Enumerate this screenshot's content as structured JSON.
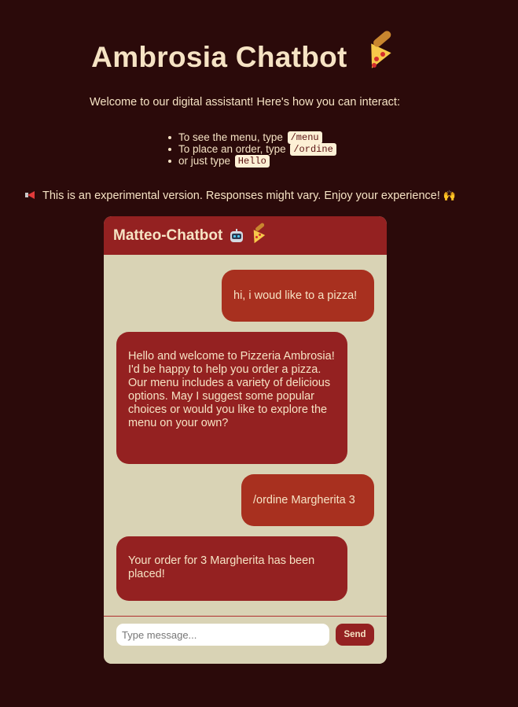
{
  "page": {
    "title": "Ambrosia Chatbot",
    "title_icon": "pizza-icon",
    "welcome": "Welcome to our digital assistant! Here's how you can interact:",
    "instructions": [
      {
        "text": "To see the menu, type",
        "code": "/menu"
      },
      {
        "text": "To place an order, type",
        "code": "/ordine"
      },
      {
        "text": "or just type",
        "code": "Hello"
      }
    ],
    "notice": {
      "icon": "megaphone-icon",
      "text": "This is an experimental version. Responses might vary. Enjoy your experience!",
      "trailing_icon": "raising-hands-icon"
    }
  },
  "chat": {
    "header_title": "Matteo-Chatbot",
    "header_icons": [
      "robot-icon",
      "pizza-icon"
    ],
    "messages": [
      {
        "sender": "user",
        "text": "hi, i woud like to a pizza!"
      },
      {
        "sender": "bot",
        "text": "Hello and welcome to Pizzeria Ambrosia! I'd be happy to help you order a pizza. Our menu includes a variety of delicious options. May I suggest some popular choices or would you like to explore the menu on your own?"
      },
      {
        "sender": "user",
        "text": "/ordine Margherita 3"
      },
      {
        "sender": "bot",
        "text": "Your order for 3 Margherita has been placed!"
      }
    ],
    "input": {
      "placeholder": "Type message...",
      "value": ""
    },
    "send_label": "Send"
  },
  "colors": {
    "background": "#2b0a0a",
    "text": "#f6e3c4",
    "chat_background": "#d9d3b5",
    "header": "#942121",
    "user_bubble": "#a8301f",
    "bot_bubble": "#942121"
  }
}
